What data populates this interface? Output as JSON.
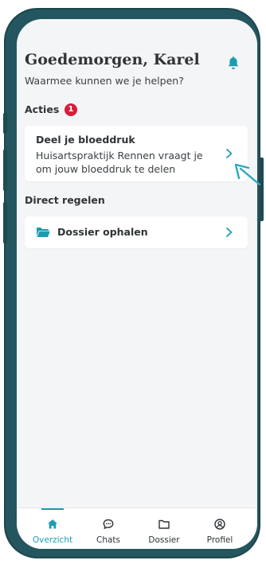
{
  "header": {
    "greeting": "Goedemorgen, Karel",
    "subtitle": "Waarmee kunnen we je helpen?"
  },
  "actions": {
    "title": "Acties",
    "badge_count": "1",
    "card": {
      "title": "Deel je bloeddruk",
      "text": "Huisartspraktijk Rennen vraagt je om jouw bloeddruk te delen"
    }
  },
  "direct": {
    "title": "Direct regelen",
    "items": [
      {
        "label": "Dossier ophalen",
        "icon": "folder-icon"
      }
    ]
  },
  "tabs": [
    {
      "label": "Overzicht",
      "icon": "home-icon",
      "active": true
    },
    {
      "label": "Chats",
      "icon": "chat-icon",
      "active": false
    },
    {
      "label": "Dossier",
      "icon": "folder-icon",
      "active": false
    },
    {
      "label": "Profiel",
      "icon": "user-circle-icon",
      "active": false
    }
  ],
  "colors": {
    "accent": "#1d9bb3",
    "badge": "#d61f3a",
    "phone_frame": "#24565f",
    "text": "#2f3437",
    "background": "#f4f5f6"
  }
}
